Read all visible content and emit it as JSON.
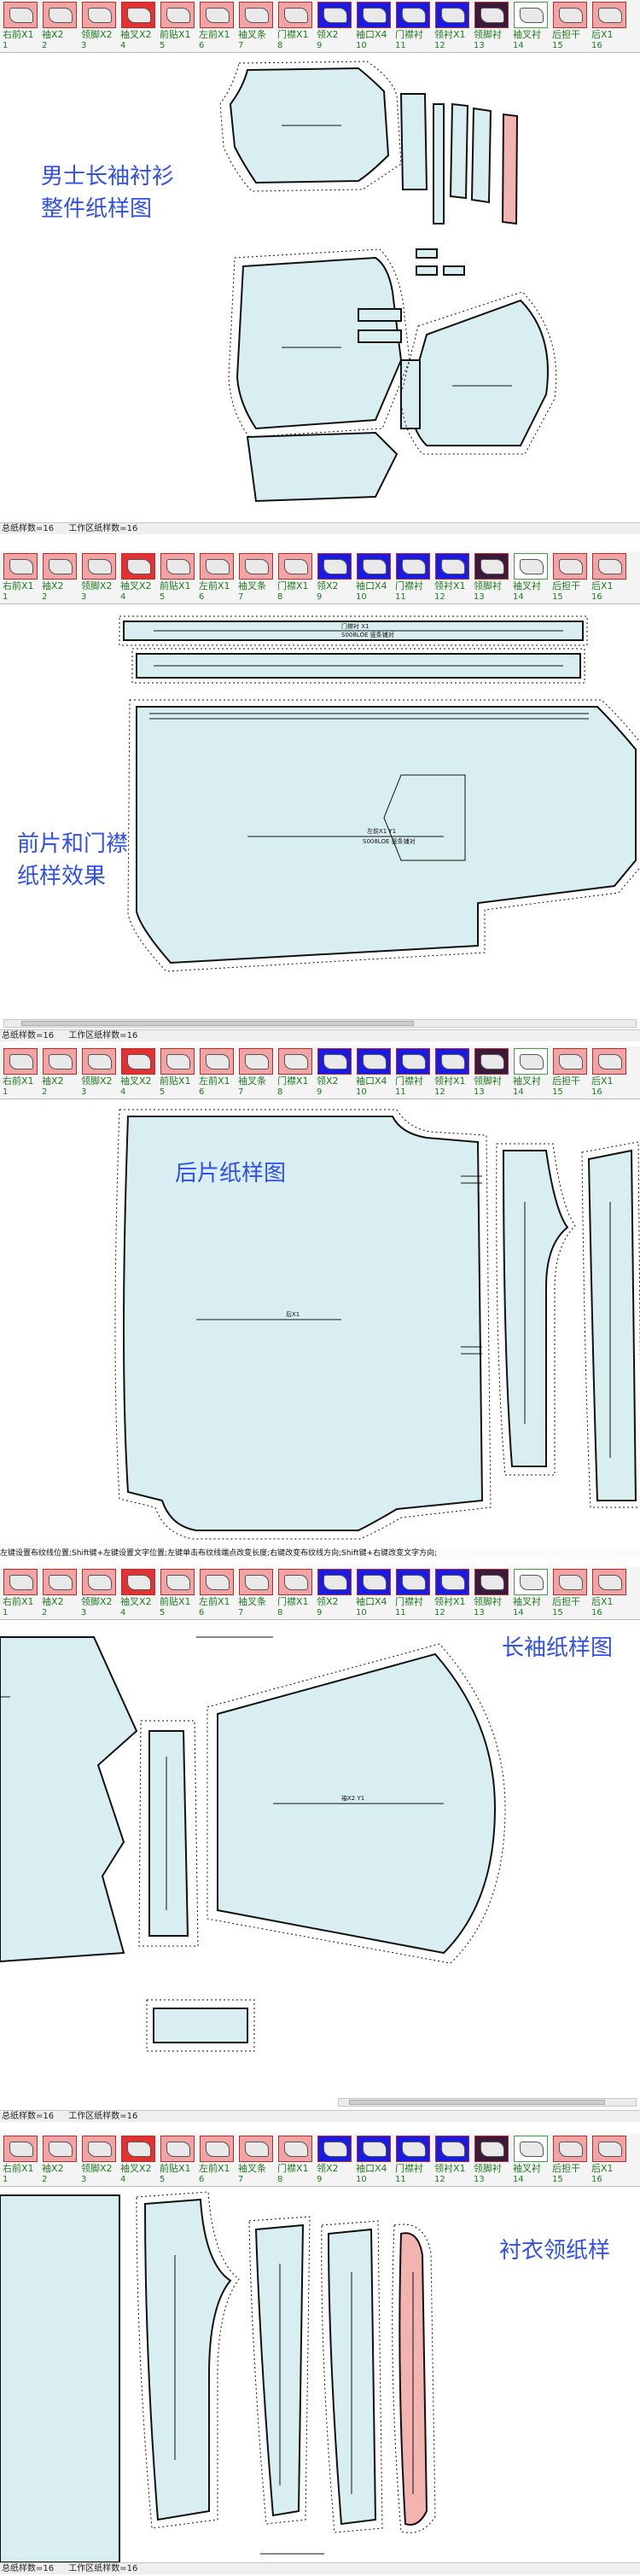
{
  "colors": {
    "pattern_fill": "#d9eef0",
    "highlight_fill": "#f3b3b0",
    "tile_pink": "#f2a3a3",
    "tile_red": "#e33131",
    "tile_blue": "#1a1ae6",
    "tile_green": "#4a9a4a",
    "tile_label": "#1f7a1f",
    "caption": "#3050e8"
  },
  "toolbar": {
    "tiles": [
      {
        "label": "右前X1",
        "count": "1",
        "color": "pink",
        "icon": "front-panel-icon"
      },
      {
        "label": "袖X2",
        "count": "2",
        "color": "pink",
        "icon": "sleeve-icon"
      },
      {
        "label": "领脚X2",
        "count": "3",
        "color": "pink",
        "icon": "collar-stand-icon"
      },
      {
        "label": "袖叉X2",
        "count": "4",
        "color": "red",
        "icon": "sleeve-placket-icon"
      },
      {
        "label": "前贴X1",
        "count": "5",
        "color": "pink",
        "icon": "front-placket-icon"
      },
      {
        "label": "左前X1",
        "count": "6",
        "color": "pink",
        "icon": "front-panel-icon"
      },
      {
        "label": "袖叉条",
        "count": "7",
        "color": "pink",
        "icon": "placket-strip-icon"
      },
      {
        "label": "门襟X1",
        "count": "8",
        "color": "pink",
        "icon": "placket-icon"
      },
      {
        "label": "领X2",
        "count": "9",
        "color": "blue",
        "icon": "collar-icon"
      },
      {
        "label": "袖口X4",
        "count": "10",
        "color": "blue",
        "icon": "cuff-icon"
      },
      {
        "label": "门襟衬",
        "count": "11",
        "color": "blue",
        "icon": "interlining-icon"
      },
      {
        "label": "领衬X1",
        "count": "12",
        "color": "blue",
        "icon": "collar-lining-icon"
      },
      {
        "label": "领脚衬",
        "count": "13",
        "color": "dark",
        "icon": "stand-lining-icon"
      },
      {
        "label": "袖叉衬",
        "count": "14",
        "color": "green",
        "icon": "placket-lining-icon"
      },
      {
        "label": "后担干",
        "count": "15",
        "color": "pink",
        "icon": "back-yoke-icon"
      },
      {
        "label": "后X1",
        "count": "16",
        "color": "pink",
        "icon": "back-panel-icon"
      }
    ]
  },
  "status": {
    "total": "总纸样数=16",
    "workspace": "工作区纸样数=16"
  },
  "hint": "左键设置布纹线位置;Shift键+左键设置文字位置;左键单击布纹线端点改变长度;右键改变布纹线方向;Shift键+右键改变文字方向;",
  "captions": {
    "overview_line1": "男士长袖衬衫",
    "overview_line2": "整件纸样图",
    "front_line1": "前片和门襟",
    "front_line2": "纸样效果",
    "back": "后片纸样图",
    "sleeve": "长袖纸样图",
    "collar": "衬衣领纸样"
  },
  "piece_labels": {
    "placket": "门襟衬 X1",
    "placket_sub": "S008LOE 竖条铺对",
    "front": "左前X1 Y1",
    "front_sub": "S008LOE 竖条铺对",
    "back": "后X1",
    "sleeve": "袖X2 Y1"
  }
}
